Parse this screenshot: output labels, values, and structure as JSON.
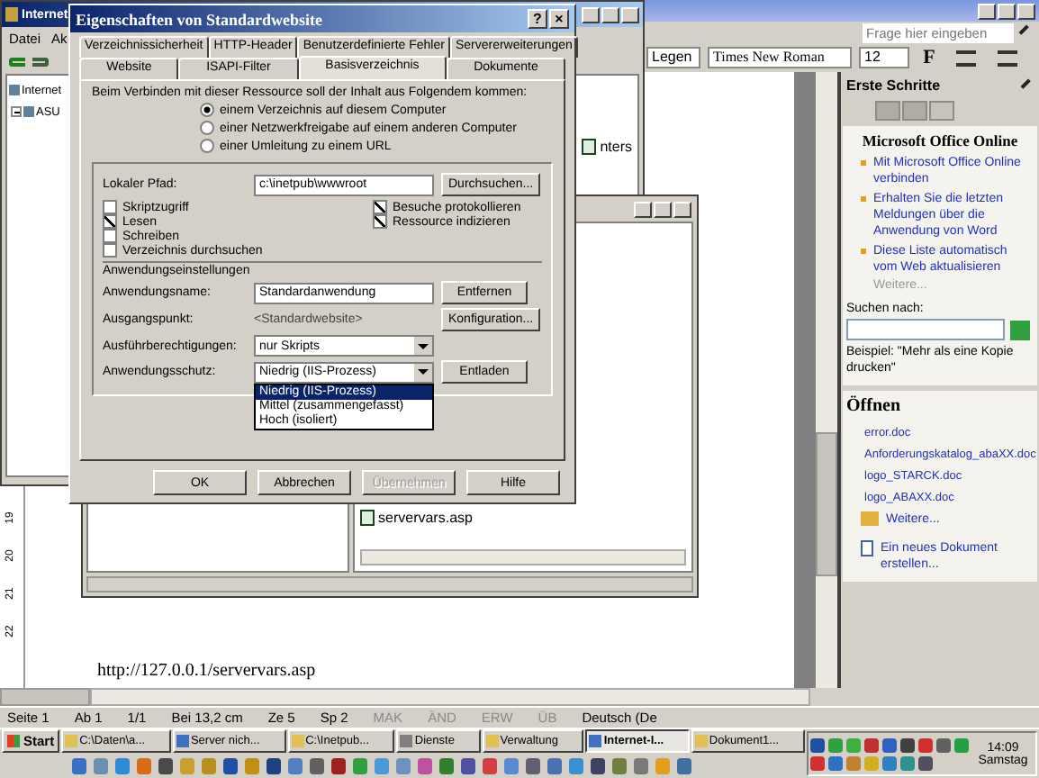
{
  "word": {
    "help_placeholder": "Frage hier eingeben",
    "toolbar": {
      "style": "Legen",
      "font": "Times New Roman",
      "size": "12",
      "bold": "F"
    },
    "ruler_numbers": [
      "19",
      "20",
      "21",
      "22"
    ],
    "document_text": "http://127.0.0.1/servervars.asp",
    "status_bar": [
      {
        "text": "Seite 1",
        "disabled": false
      },
      {
        "text": "Ab 1",
        "disabled": false
      },
      {
        "text": "1/1",
        "disabled": false
      },
      {
        "text": "Bei 13,2 cm",
        "disabled": false
      },
      {
        "text": "Ze 5",
        "disabled": false
      },
      {
        "text": "Sp 2",
        "disabled": false
      },
      {
        "text": "MAK",
        "disabled": true
      },
      {
        "text": "ÄND",
        "disabled": true
      },
      {
        "text": "ERW",
        "disabled": true
      },
      {
        "text": "ÜB",
        "disabled": true
      },
      {
        "text": "Deutsch (De",
        "disabled": false
      }
    ]
  },
  "task_pane": {
    "title": "Erste Schritte",
    "heading": "Microsoft Office Online",
    "links": [
      "Mit Microsoft Office Online verbinden",
      "Erhalten Sie die letzten Meldungen über die Anwendung von Word",
      "Diese Liste automatisch vom Web aktualisieren"
    ],
    "more": "Weitere...",
    "search_label": "Suchen nach:",
    "example": "Beispiel: \"Mehr als eine Kopie drucken\"",
    "open_heading": "Öffnen",
    "files": [
      "error.doc",
      "Anforderungskatalog_abaXX.doc",
      "logo_STARCK.doc",
      "logo_ABAXX.doc"
    ],
    "open_more": "Weitere...",
    "new_document": "Ein neues Dokument erstellen..."
  },
  "iis": {
    "title": "Internet",
    "menu": [
      "Datei",
      "Ak"
    ],
    "tree": [
      {
        "label": "Internet",
        "children": [
          {
            "label": "ASU",
            "expanded": true
          }
        ]
      }
    ],
    "files": [
      "nters"
    ]
  },
  "explorer": {
    "files": [
      "servervars.asp"
    ]
  },
  "dialog": {
    "title": "Eigenschaften von Standardwebsite",
    "title_buttons": [
      "?",
      "×"
    ],
    "tab_rows": [
      [
        {
          "label": "Verzeichnissicherheit",
          "selected": false
        },
        {
          "label": "HTTP-Header",
          "selected": false
        },
        {
          "label": "Benutzerdefinierte Fehler",
          "selected": false
        },
        {
          "label": "Servererweiterungen",
          "selected": false
        }
      ],
      [
        {
          "label": "Website",
          "selected": false
        },
        {
          "label": "ISAPI-Filter",
          "selected": false
        },
        {
          "label": "Basisverzeichnis",
          "selected": true
        },
        {
          "label": "Dokumente",
          "selected": false
        }
      ]
    ],
    "intro": "Beim Verbinden mit dieser Ressource soll der Inhalt aus Folgendem kommen:",
    "sources": [
      {
        "label": "einem Verzeichnis auf diesem Computer",
        "selected": true
      },
      {
        "label": "einer Netzwerkfreigabe auf einem anderen Computer",
        "selected": false
      },
      {
        "label": "einer Umleitung zu einem URL",
        "selected": false
      }
    ],
    "path_label": "Lokaler Pfad:",
    "path": "c:\\inetpub\\wwwroot",
    "browse": "Durchsuchen...",
    "checks_left": [
      {
        "label": "Skriptzugriff",
        "checked": false
      },
      {
        "label": "Lesen",
        "checked": true
      },
      {
        "label": "Schreiben",
        "checked": false
      },
      {
        "label": "Verzeichnis durchsuchen",
        "checked": false
      }
    ],
    "checks_right": [
      {
        "label": "Besuche protokollieren",
        "checked": true
      },
      {
        "label": "Ressource indizieren",
        "checked": true
      }
    ],
    "app_section": "Anwendungseinstellungen",
    "app_name_label": "Anwendungsname:",
    "app_name": "Standardanwendung",
    "remove": "Entfernen",
    "start_label": "Ausgangspunkt:",
    "start": "<Standardwebsite>",
    "config": "Konfiguration...",
    "exec_label": "Ausführberechtigungen:",
    "exec": "nur Skripts",
    "protect_label": "Anwendungsschutz:",
    "protect": "Niedrig (IIS-Prozess)",
    "unload": "Entladen",
    "protect_options": [
      {
        "label": "Niedrig (IIS-Prozess)",
        "selected": true
      },
      {
        "label": "Mittel (zusammengefasst)",
        "selected": false
      },
      {
        "label": "Hoch (isoliert)",
        "selected": false
      }
    ],
    "buttons": [
      {
        "label": "OK",
        "disabled": false
      },
      {
        "label": "Abbrechen",
        "disabled": false
      },
      {
        "label": "Übernehmen",
        "disabled": true
      },
      {
        "label": "Hilfe",
        "disabled": false
      }
    ]
  },
  "taskbar": {
    "start": "Start",
    "tasks": [
      {
        "label": "C:\\Daten\\a...",
        "selected": false
      },
      {
        "label": "Server nich...",
        "selected": false
      },
      {
        "label": "C:\\Inetpub...",
        "selected": false
      },
      {
        "label": "Dienste",
        "selected": false
      },
      {
        "label": "Verwaltung",
        "selected": false
      },
      {
        "label": "Internet-I...",
        "selected": true
      },
      {
        "label": "Dokument1...",
        "selected": false
      }
    ],
    "time": "14:09",
    "day": "Samstag"
  }
}
